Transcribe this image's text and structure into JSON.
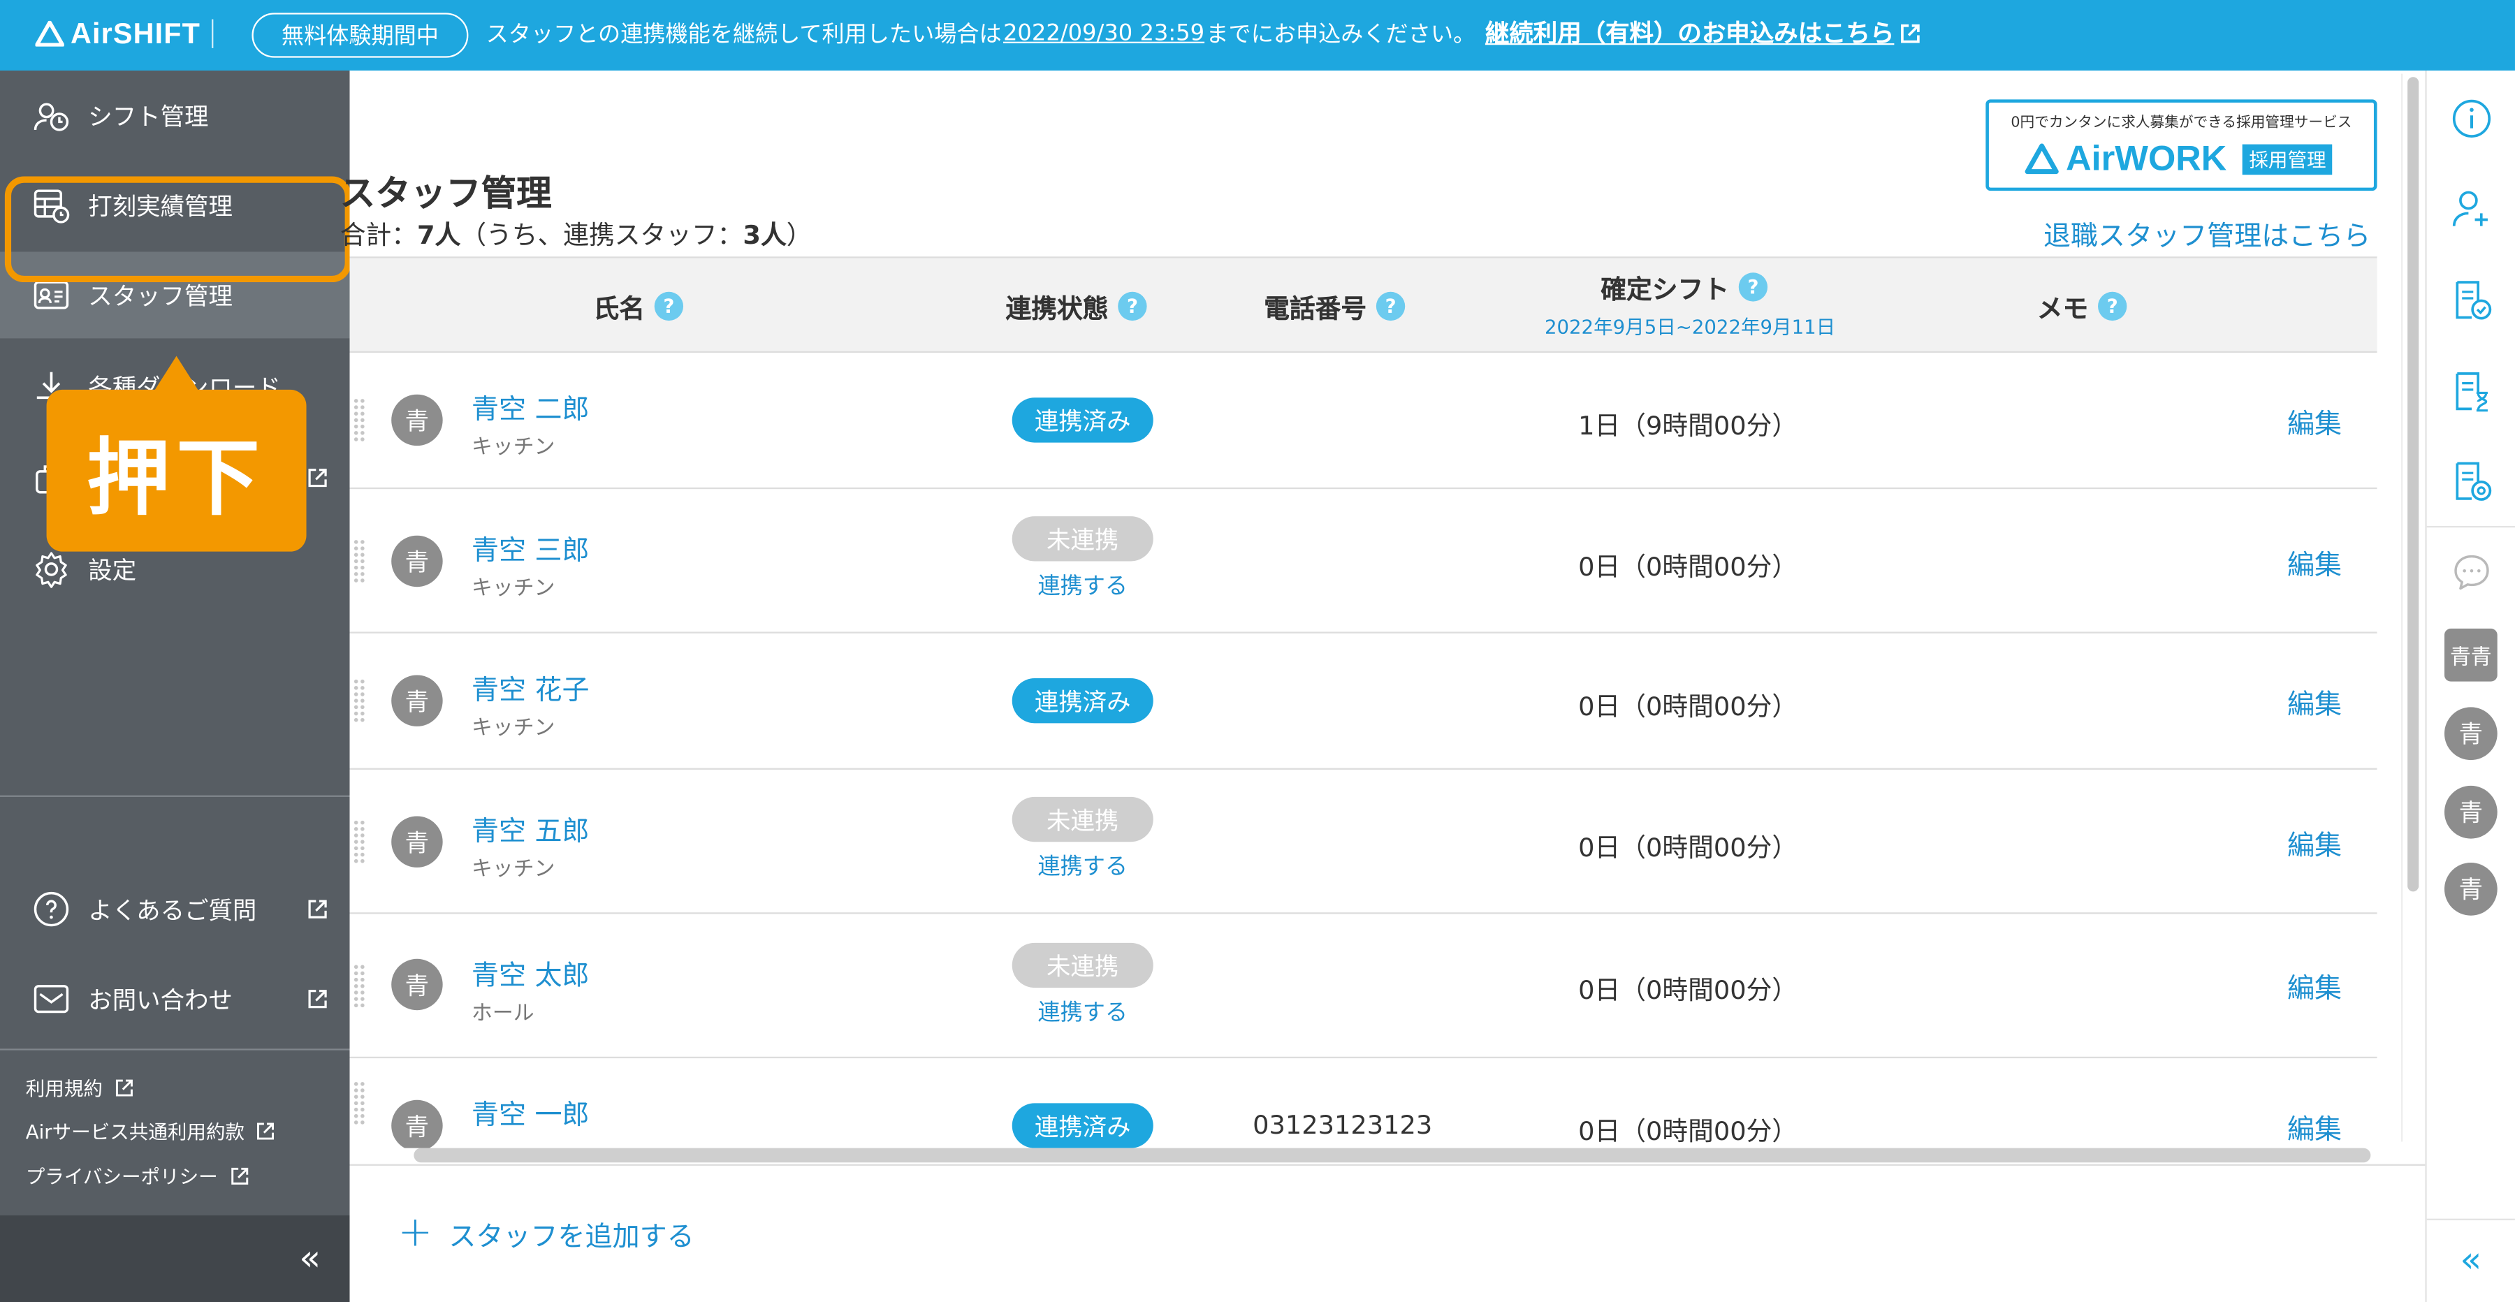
{
  "banner": {
    "logo": "AirSHIFT",
    "trial_badge": "無料体験期間中",
    "notice_pre": "スタッフとの連携機能を継続して利用したい場合は",
    "notice_deadline": "2022/09/30 23:59",
    "notice_post": "までにお申込みください。",
    "cta": "継続利用（有料）のお申込みはこちら"
  },
  "sidebar": {
    "items": [
      {
        "label": "シフト管理",
        "icon": "shift-clock-icon"
      },
      {
        "label": "打刻実績管理",
        "icon": "timesheet-icon"
      },
      {
        "label": "スタッフ管理",
        "icon": "staff-card-icon"
      },
      {
        "label": "各種ダウンロード",
        "icon": "download-icon"
      },
      {
        "label": "",
        "icon": "bag-icon"
      },
      {
        "label": "設定",
        "icon": "gear-icon"
      }
    ],
    "help": "よくあるご質問",
    "contact": "お問い合わせ",
    "links": [
      "利用規約",
      "Airサービス共通利用約款",
      "プライバシーポリシー"
    ],
    "collapse": "«"
  },
  "callout": {
    "text": "押下",
    "color": "#f39800"
  },
  "airwork": {
    "tagline": "0円でカンタンに求人募集ができる採用管理サービス",
    "name": "AirWORK",
    "tag": "採用管理"
  },
  "page": {
    "title": "スタッフ管理",
    "total_prefix": "合計：",
    "total_count": "7人",
    "total_mid": "（うち、連携スタッフ：",
    "linked_count": "3人",
    "total_suffix": "）",
    "retired_link": "退職スタッフ管理はこちら"
  },
  "table": {
    "headers": {
      "name": "氏名",
      "status": "連携状態",
      "phone": "電話番号",
      "shift": "確定シフト",
      "memo": "メモ"
    },
    "shift_range": "2022年9月5日~2022年9月11日",
    "rows": [
      {
        "avatar": "青",
        "name": "青空 二郎",
        "dept": "キッチン",
        "status": "連携済み",
        "linked": true,
        "link_action": "",
        "phone": "",
        "shift": "1日（9時間00分）",
        "edit": "編集"
      },
      {
        "avatar": "青",
        "name": "青空 三郎",
        "dept": "キッチン",
        "status": "未連携",
        "linked": false,
        "link_action": "連携する",
        "phone": "",
        "shift": "0日（0時間00分）",
        "edit": "編集"
      },
      {
        "avatar": "青",
        "name": "青空 花子",
        "dept": "キッチン",
        "status": "連携済み",
        "linked": true,
        "link_action": "",
        "phone": "",
        "shift": "0日（0時間00分）",
        "edit": "編集"
      },
      {
        "avatar": "青",
        "name": "青空 五郎",
        "dept": "キッチン",
        "status": "未連携",
        "linked": false,
        "link_action": "連携する",
        "phone": "",
        "shift": "0日（0時間00分）",
        "edit": "編集"
      },
      {
        "avatar": "青",
        "name": "青空 太郎",
        "dept": "ホール",
        "status": "未連携",
        "linked": false,
        "link_action": "連携する",
        "phone": "",
        "shift": "0日（0時間00分）",
        "edit": "編集"
      },
      {
        "avatar": "青",
        "name": "青空 一郎",
        "dept": "",
        "status": "連携済み",
        "linked": true,
        "link_action": "",
        "phone": "03123123123",
        "shift": "0日（0時間00分）",
        "edit": "編集"
      }
    ]
  },
  "footer": {
    "add_staff": "スタッフを追加する"
  },
  "rail": {
    "icons": [
      "info-icon",
      "add-user-icon",
      "document-check-icon",
      "hourglass-doc-icon",
      "settings-doc-icon",
      "chat-icon"
    ],
    "group_avatar": "青青",
    "avatars": [
      "青",
      "青",
      "青"
    ],
    "collapse": "«"
  },
  "colors": {
    "brand": "#1ea7df",
    "sidebar": "#575d63",
    "accent": "#f39800",
    "link": "#1e8fd0"
  }
}
